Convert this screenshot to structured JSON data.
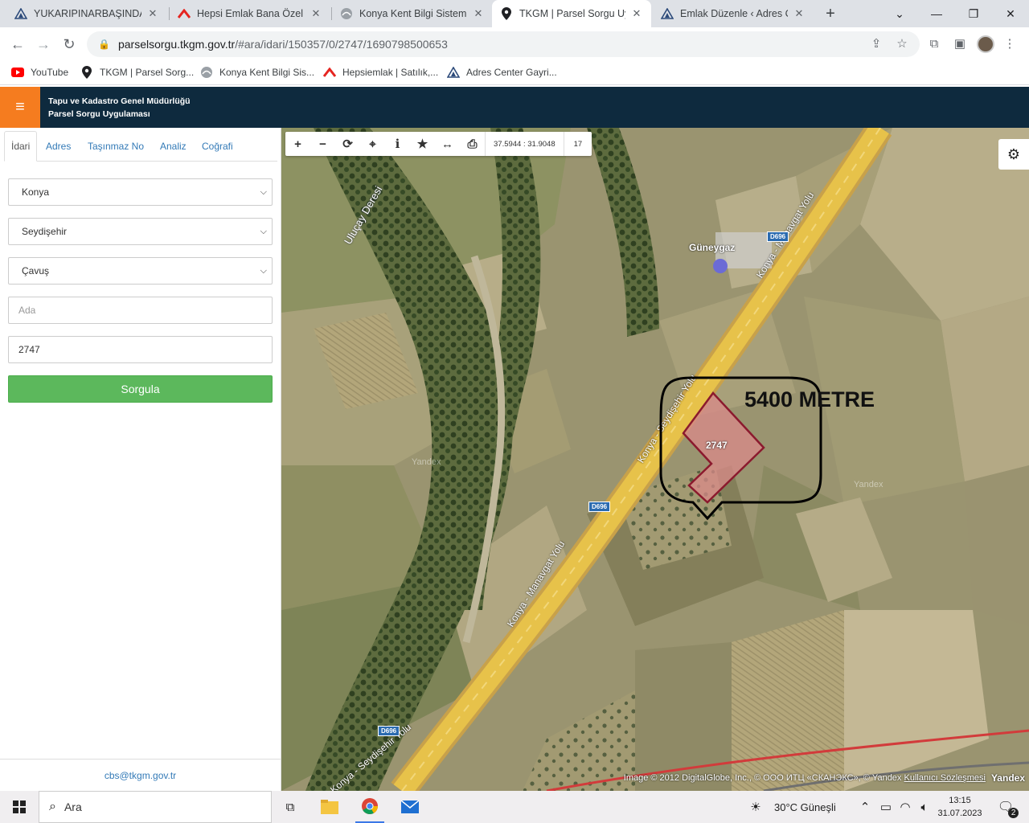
{
  "browser": {
    "tabs": [
      {
        "title": "YUKARIPINARBAŞINDA KONYA",
        "icon": "adres-center-icon"
      },
      {
        "title": "Hepsi Emlak Bana Özel",
        "icon": "hepsiemlak-icon"
      },
      {
        "title": "Konya Kent Bilgi Sistemi",
        "icon": "konya-logo-icon"
      },
      {
        "title": "TKGM | Parsel Sorgu Uygulaması",
        "icon": "map-pin-icon"
      },
      {
        "title": "Emlak Düzenle ‹ Adres Center",
        "icon": "adres-center-icon"
      }
    ],
    "active_tab": 3,
    "url_host": "parselsorgu.tkgm.gov.tr",
    "url_path": "/#ara/idari/150357/0/2747/1690798500653",
    "bookmarks": [
      {
        "label": "YouTube",
        "icon": "youtube-icon"
      },
      {
        "label": "TKGM | Parsel Sorg...",
        "icon": "map-pin-icon"
      },
      {
        "label": "Konya Kent Bilgi Sis...",
        "icon": "konya-logo-icon"
      },
      {
        "label": "Hepsiemlak | Satılık,...",
        "icon": "hepsiemlak-icon"
      },
      {
        "label": "Adres Center Gayri...",
        "icon": "adres-center-icon"
      }
    ]
  },
  "app": {
    "title_line1": "Tapu ve Kadastro Genel Müdürlüğü",
    "title_line2": "Parsel Sorgu Uygulaması",
    "accent": "#f57c1f",
    "header_bg": "#0e2a3e"
  },
  "panel": {
    "tabs": [
      "İdari",
      "Adres",
      "Taşınmaz No",
      "Analiz",
      "Coğrafi"
    ],
    "active_tab": "İdari",
    "il": "Konya",
    "ilce": "Seydişehir",
    "mahalle": "Çavuş",
    "ada_placeholder": "Ada",
    "parsel_value": "2747",
    "submit_label": "Sorgula",
    "footer_email": "cbs@tkgm.gov.tr",
    "button_color": "#5cb85c"
  },
  "map": {
    "coords": "37.5944 : 31.9048",
    "zoom": "17",
    "parcel_label": "2747",
    "annotation": "5400 METRE",
    "poi_label": "Güneygaz",
    "road_badge": "D696",
    "road_label_1": "Konya - Manavgat Yolu",
    "road_label_2": "Konya - Seydişehir Yolu",
    "stream_label": "Uluçay Deresi",
    "watermark": "Yandex",
    "attribution": "Image © 2012 DigitalGlobe, Inc., © ООО ИТЦ «СКАНЭКС», © Yandex",
    "terms_link": "Kullanıcı Sözleşmesi",
    "logo": "Yandex",
    "parcel_color": "#8b1a2e"
  },
  "taskbar": {
    "search_label": "Ara",
    "weather": "30°C  Güneşli",
    "time": "13:15",
    "date": "31.07.2023",
    "notifications": "2"
  }
}
